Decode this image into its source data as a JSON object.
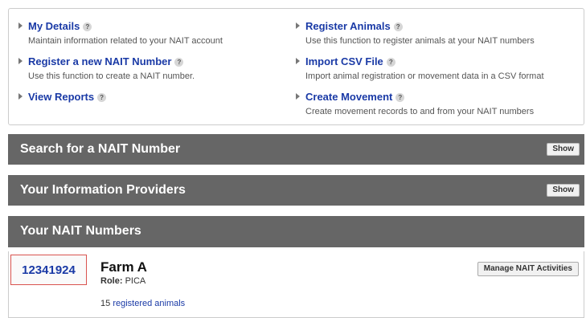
{
  "menu": {
    "left": [
      {
        "label": "My Details",
        "desc": "Maintain information related to your NAIT account"
      },
      {
        "label": "Register a new NAIT Number",
        "desc": "Use this function to create a NAIT number."
      },
      {
        "label": "View Reports",
        "desc": ""
      }
    ],
    "right": [
      {
        "label": "Register Animals",
        "desc": "Use this function to register animals at your NAIT numbers"
      },
      {
        "label": "Import CSV File",
        "desc": "Import animal registration or movement data in a CSV format"
      },
      {
        "label": "Create Movement",
        "desc": "Create movement records to and from your NAIT numbers"
      }
    ],
    "help_glyph": "?"
  },
  "panels": {
    "search": {
      "title": "Search for a NAIT Number",
      "button": "Show"
    },
    "providers": {
      "title": "Your Information Providers",
      "button": "Show"
    },
    "numbers": {
      "title": "Your NAIT Numbers"
    }
  },
  "nait_entry": {
    "number": "12341924",
    "farm": "Farm A",
    "role_label": "Role:",
    "role_value": "PICA",
    "animal_count": "15",
    "animals_link": "registered animals",
    "manage_button": "Manage NAIT Activities"
  },
  "colors": {
    "link": "#1a3aa6",
    "panel_bar": "#666666",
    "highlight_border": "#d9534f"
  }
}
